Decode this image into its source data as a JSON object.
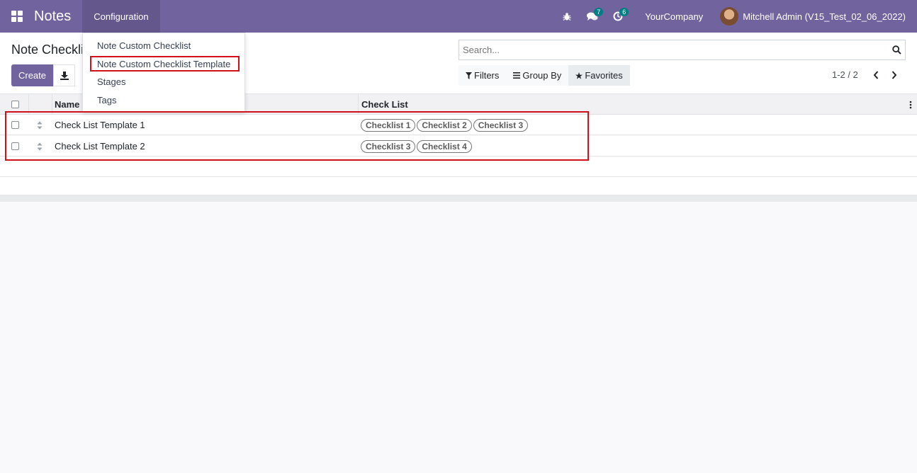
{
  "navbar": {
    "app_title": "Notes",
    "menu": "Configuration",
    "chat_badge": "7",
    "activity_badge": "6",
    "company": "YourCompany",
    "user": "Mitchell Admin (V15_Test_02_06_2022)"
  },
  "dropdown": {
    "items": [
      "Note Custom Checklist",
      "Note Custom Checklist Template",
      "Stages",
      "Tags"
    ]
  },
  "control": {
    "title": "Note Checklist Template",
    "create_label": "Create",
    "search_placeholder": "Search...",
    "filters_label": "Filters",
    "groupby_label": "Group By",
    "favorites_label": "Favorites",
    "pager": "1-2 / 2"
  },
  "table": {
    "headers": [
      "Name",
      "Check List"
    ],
    "rows": [
      {
        "name": "Check List Template 1",
        "tags": [
          "Checklist 1",
          "Checklist 2",
          "Checklist 3"
        ]
      },
      {
        "name": "Check List Template 2",
        "tags": [
          "Checklist 3",
          "Checklist 4"
        ]
      }
    ]
  },
  "colors": {
    "brand": "#71639e",
    "highlight": "#d0101b"
  }
}
